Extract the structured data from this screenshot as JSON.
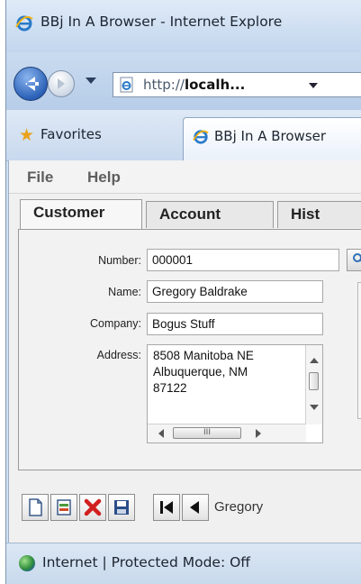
{
  "window": {
    "title": "BBj In A Browser - Internet Explore"
  },
  "navigation": {
    "address_prefix": "http://",
    "address_host": "localh...",
    "address_suffix": ""
  },
  "favorites_bar": {
    "favorites_label": "Favorites",
    "tab_title": "BBj In A Browser"
  },
  "menu": {
    "items": [
      "File",
      "Help"
    ]
  },
  "form_tabs": [
    "Customer",
    "Account",
    "Hist"
  ],
  "customer_form": {
    "number_label": "Number:",
    "number_value": "000001",
    "name_label": "Name:",
    "name_value": "Gregory Baldrake",
    "company_label": "Company:",
    "company_value": "Bogus Stuff",
    "address_label": "Address:",
    "address_lines": [
      "8508 Manitoba NE",
      "Albuquerque, NM",
      "87122"
    ],
    "hscroll_grip": "III"
  },
  "toolbar": {
    "record_text": "Gregory"
  },
  "status": {
    "text": "Internet | Protected Mode: Off"
  },
  "icons": {
    "title": "ie-logo-icon",
    "back": "back-arrow-icon",
    "forward": "forward-arrow-icon",
    "page": "ie-page-icon",
    "favorites": "star-icon",
    "new": "new-record-icon",
    "revert": "revert-icon",
    "delete": "delete-icon",
    "save": "save-icon",
    "first": "first-record-icon",
    "previous": "previous-record-icon",
    "zone": "internet-globe-icon"
  },
  "colors": {
    "chrome_blue": "#cfe0f2",
    "delete_red": "#d11f1f",
    "star_gold": "#e9a21b",
    "form_bg": "#f0f0f0"
  }
}
